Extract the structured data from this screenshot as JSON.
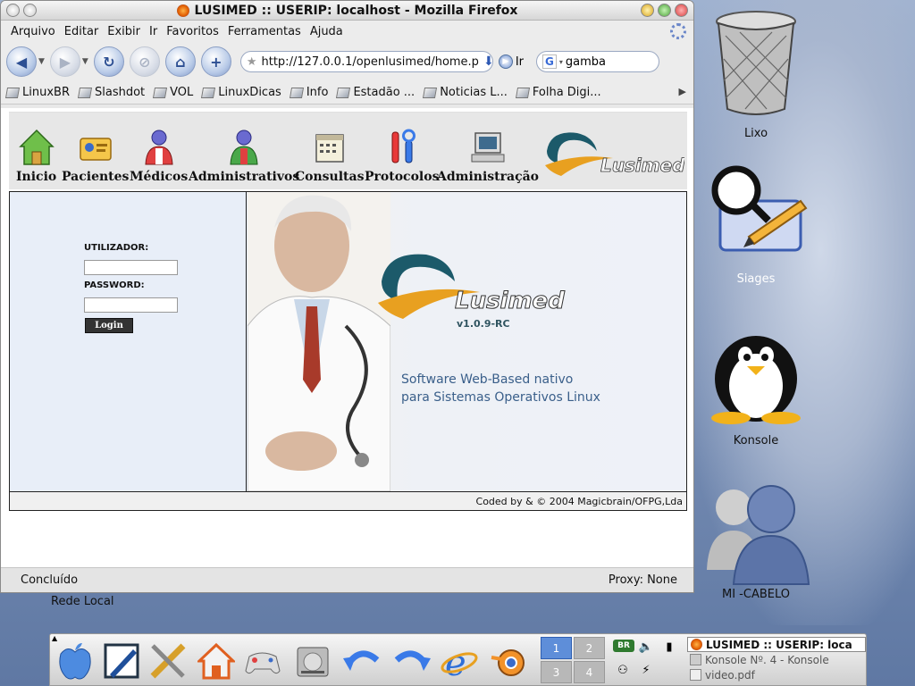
{
  "window": {
    "title": "LUSIMED :: USERIP: localhost - Mozilla Firefox"
  },
  "menu": [
    "Arquivo",
    "Editar",
    "Exibir",
    "Ir",
    "Favoritos",
    "Ferramentas",
    "Ajuda"
  ],
  "navbar": {
    "url": "http://127.0.0.1/openlusimed/home.p",
    "go_label": "Ir",
    "search_value": "gamba"
  },
  "bookmarks": [
    "LinuxBR",
    "Slashdot",
    "VOL",
    "LinuxDicas",
    "Info",
    "Estadão ...",
    "Noticias L...",
    "Folha Digi..."
  ],
  "app_nav": [
    "Inicio",
    "Pacientes",
    "Médicos",
    "Administrativos",
    "Consultas",
    "Protocolos",
    "Administração"
  ],
  "brand": {
    "name": "Lusimed",
    "version": "v1.0.9-RC",
    "tagline_line1": "Software Web-Based nativo",
    "tagline_line2": "para Sistemas Operativos Linux",
    "copyright": "Coded by & © 2004 Magicbrain/OFPG,Lda"
  },
  "login": {
    "user_label": "UTILIZADOR:",
    "user_value": "",
    "password_label": "PASSWORD:",
    "password_value": "",
    "button_label": "Login"
  },
  "status": {
    "left": "Concluído",
    "right": "Proxy: None"
  },
  "desktop": {
    "icons": [
      "Lixo",
      "Siages",
      "Konsole",
      "MI -CABELO",
      "Rede Local"
    ]
  },
  "dock": {
    "desktops": [
      "1",
      "2",
      "3",
      "4"
    ],
    "active_desktop": "1",
    "tasks": [
      "LUSIMED :: USERIP: loca",
      "Konsole Nº. 4 - Konsole",
      "video.pdf"
    ]
  },
  "colors": {
    "accent_orange": "#e8a020",
    "accent_teal": "#1c5a6a",
    "panel_bg": "#e8eef8"
  }
}
